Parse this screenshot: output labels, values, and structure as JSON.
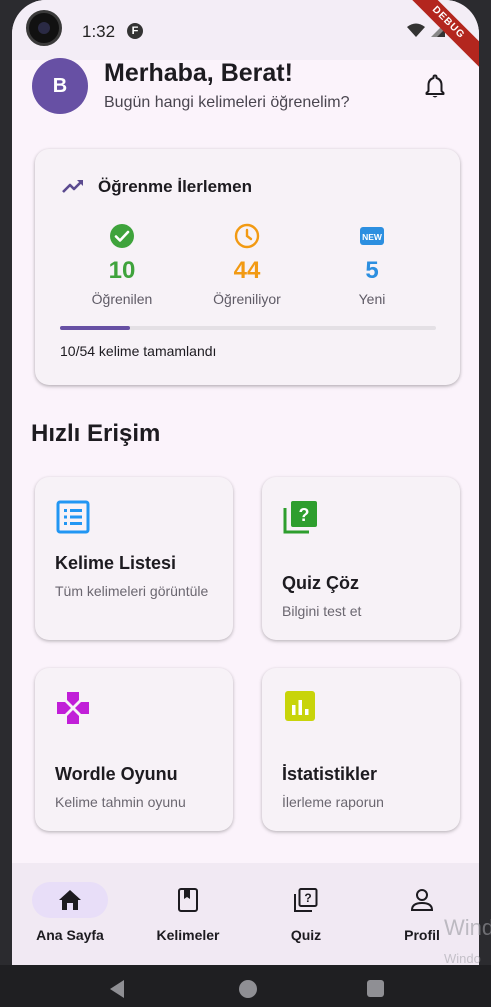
{
  "status_bar": {
    "time": "1:32",
    "app_indicator": "F",
    "debug_label": "DEBUG"
  },
  "header": {
    "avatar_letter": "B",
    "greeting": "Merhaba, Berat!",
    "subtitle": "Bugün hangi kelimeleri öğrenelim?",
    "notification_icon": "bell-icon"
  },
  "progress_card": {
    "title": "Öğrenme İlerlemen",
    "title_icon": "trending-up-icon",
    "stats": [
      {
        "icon": "check-circle-icon",
        "value": "10",
        "label": "Öğrenilen",
        "color": "#3fa33c"
      },
      {
        "icon": "clock-icon",
        "value": "44",
        "label": "Öğreniliyor",
        "color": "#f29a13"
      },
      {
        "icon": "new-badge-icon",
        "value": "5",
        "label": "Yeni",
        "color": "#2c8fe0"
      }
    ],
    "progress_fraction": 0.185,
    "footer": "10/54 kelime tamamlandı"
  },
  "quick_access": {
    "title": "Hızlı Erişim",
    "cards": [
      {
        "icon": "list-icon",
        "title": "Kelime Listesi",
        "description": "Tüm kelimeleri görüntüle",
        "color": "#2196f3"
      },
      {
        "icon": "quiz-icon",
        "title": "Quiz Çöz",
        "description": "Bilgini test et",
        "color": "#2e9e2e"
      },
      {
        "icon": "gamepad-icon",
        "title": "Wordle Oyunu",
        "description": "Kelime tahmin oyunu",
        "color": "#c11ed8"
      },
      {
        "icon": "bar-chart-icon",
        "title": "İstatistikler",
        "description": "İlerleme raporun",
        "color": "#c8d40a"
      }
    ]
  },
  "bottom_nav": {
    "items": [
      {
        "icon": "home-icon",
        "label": "Ana Sayfa",
        "active": true
      },
      {
        "icon": "book-icon",
        "label": "Kelimeler",
        "active": false
      },
      {
        "icon": "quiz-icon",
        "label": "Quiz",
        "active": false
      },
      {
        "icon": "person-icon",
        "label": "Profil",
        "active": false
      }
    ]
  },
  "watermark": {
    "line1": "Wind",
    "line2": "Windo"
  }
}
